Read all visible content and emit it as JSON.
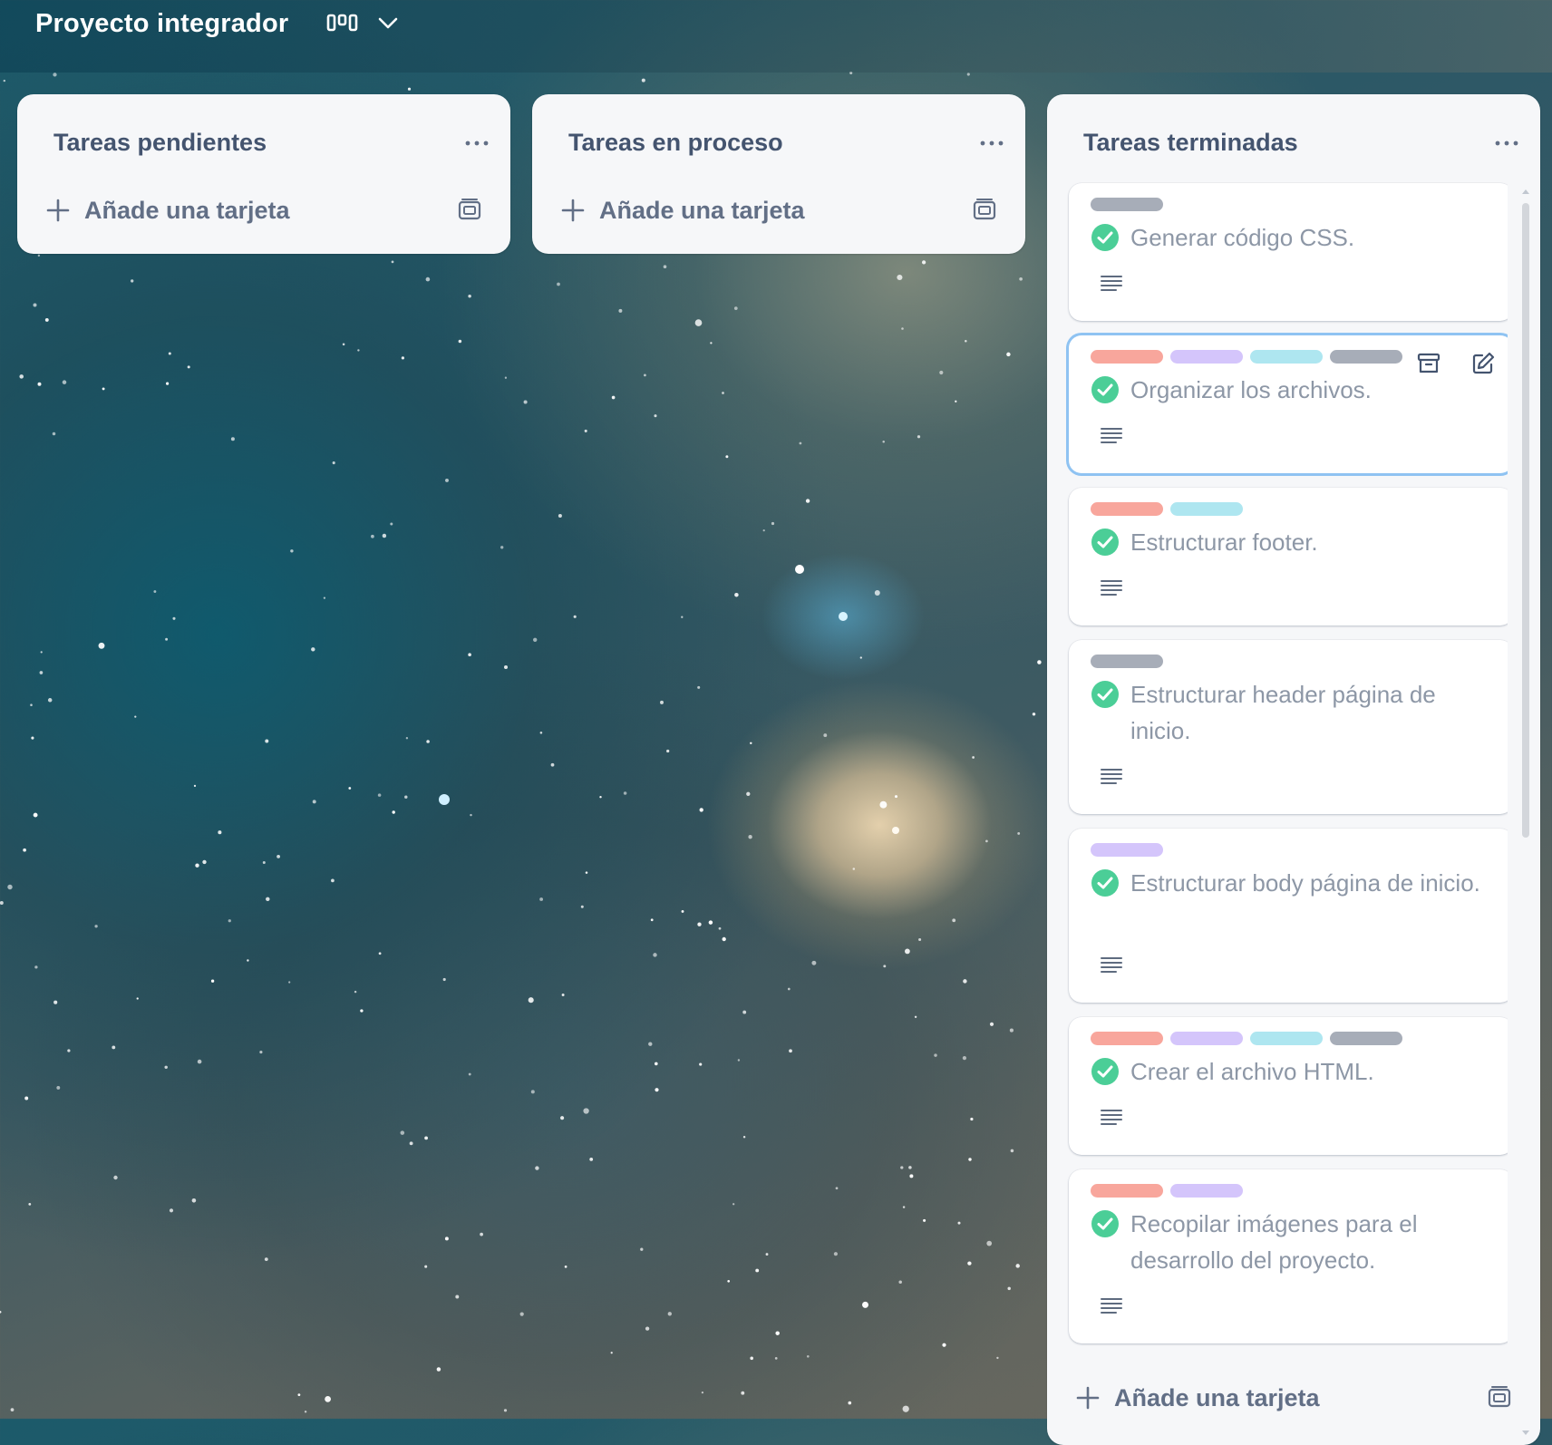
{
  "board": {
    "title": "Proyecto integrador",
    "view_icon": "board-view-icon",
    "dropdown_icon": "chevron-down-icon"
  },
  "lists": [
    {
      "title": "Tareas pendientes",
      "add_card_label": "Añade una tarjeta",
      "cards": []
    },
    {
      "title": "Tareas en proceso",
      "add_card_label": "Añade una tarjeta",
      "cards": []
    },
    {
      "title": "Tareas terminadas",
      "add_card_label": "Añade una tarjeta",
      "cards": [
        {
          "title": "Generar código CSS.",
          "labels": [
            "gray"
          ],
          "completed": true,
          "has_description": true
        },
        {
          "title": "Organizar los archivos.",
          "labels": [
            "red",
            "purple",
            "cyan",
            "gray"
          ],
          "completed": true,
          "has_description": true,
          "selected": true
        },
        {
          "title": "Estructurar footer.",
          "labels": [
            "red",
            "cyan"
          ],
          "completed": true,
          "has_description": true
        },
        {
          "title": "Estructurar header página de inicio.",
          "labels": [
            "gray"
          ],
          "completed": true,
          "has_description": true
        },
        {
          "title": "Estructurar body página de inicio.",
          "labels": [
            "purple"
          ],
          "completed": true,
          "has_description": true
        },
        {
          "title": "Crear el archivo HTML.",
          "labels": [
            "red",
            "purple",
            "cyan",
            "gray"
          ],
          "completed": true,
          "has_description": true
        },
        {
          "title": "Recopilar imágenes para el desarrollo del proyecto.",
          "labels": [
            "red",
            "purple"
          ],
          "completed": true,
          "has_description": true
        }
      ]
    }
  ],
  "colors": {
    "label_red": "#f8a69c",
    "label_purple": "#d4c5fb",
    "label_cyan": "#aee6f0",
    "label_gray": "#a7adb8",
    "complete_green": "#4bce97",
    "selected_outline": "#8fc3f2"
  },
  "icons": {
    "list_menu": "more-horizontal-icon",
    "add": "plus-icon",
    "template": "template-icon",
    "description": "description-lines-icon",
    "archive": "archive-icon",
    "edit": "edit-icon",
    "complete": "check-circle-icon"
  }
}
